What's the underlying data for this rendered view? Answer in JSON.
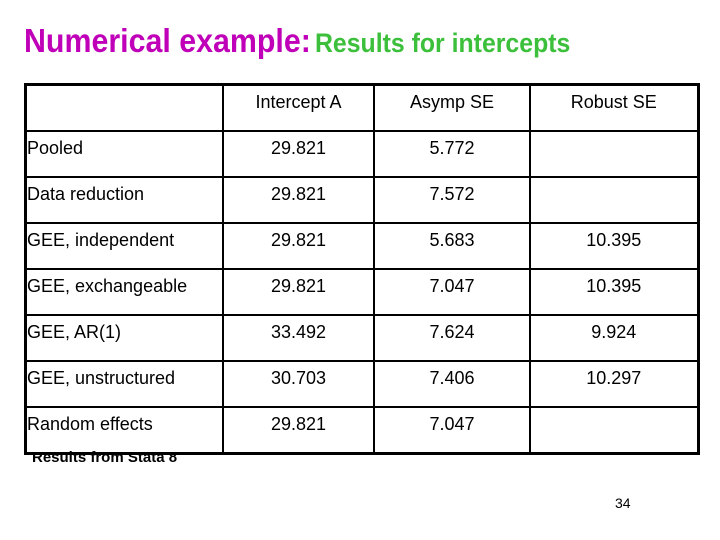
{
  "title": {
    "part1": "Numerical example:",
    "part1_color": "#c000b8",
    "part2": "Results for intercepts",
    "part2_color": "#3cc03c"
  },
  "table": {
    "headers": [
      "",
      "Intercept A",
      "Asymp SE",
      "Robust SE"
    ],
    "rows": [
      {
        "method": "Pooled",
        "intercept": "29.821",
        "asymp_se": "5.772",
        "robust_se": ""
      },
      {
        "method": "Data reduction",
        "intercept": "29.821",
        "asymp_se": "7.572",
        "robust_se": ""
      },
      {
        "method": "GEE, independent",
        "intercept": "29.821",
        "asymp_se": "5.683",
        "robust_se": "10.395"
      },
      {
        "method": "GEE, exchangeable",
        "intercept": "29.821",
        "asymp_se": "7.047",
        "robust_se": "10.395"
      },
      {
        "method": "GEE, AR(1)",
        "intercept": "33.492",
        "asymp_se": "7.624",
        "robust_se": "9.924"
      },
      {
        "method": "GEE, unstructured",
        "intercept": "30.703",
        "asymp_se": "7.406",
        "robust_se": "10.297"
      },
      {
        "method": "Random effects",
        "intercept": "29.821",
        "asymp_se": "7.047",
        "robust_se": ""
      }
    ]
  },
  "source_note": "Results from Stata 8",
  "page_number": "34"
}
